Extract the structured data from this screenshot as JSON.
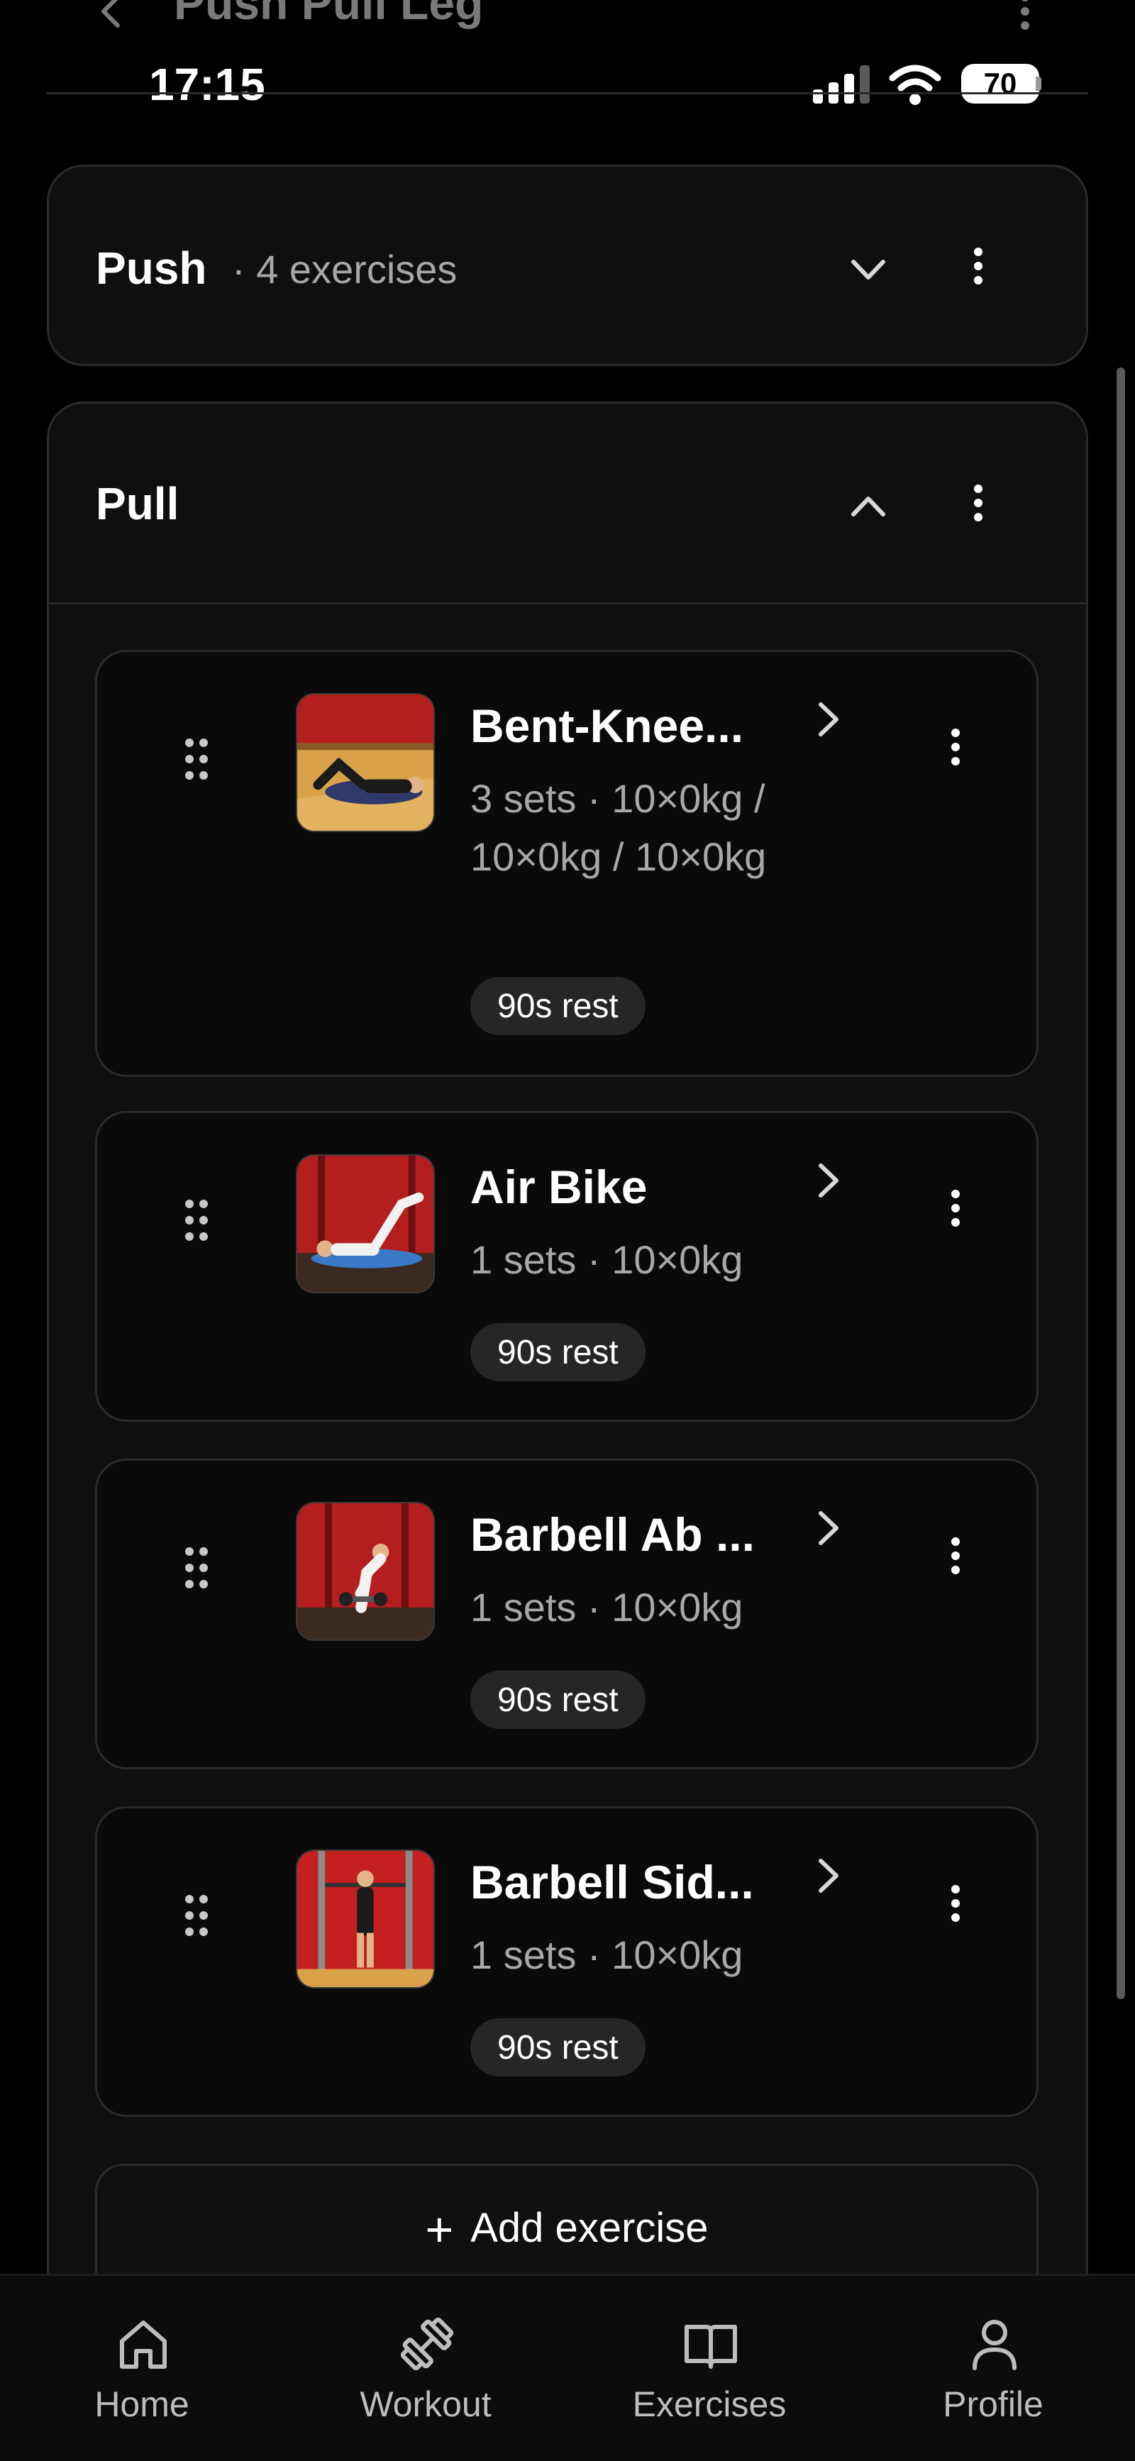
{
  "header": {
    "title": "Push Pull Leg",
    "time": "17:15",
    "battery": "70"
  },
  "days": [
    {
      "name": "Push",
      "count_text": "· 4 exercises",
      "expanded": false
    },
    {
      "name": "Pull",
      "expanded": true
    }
  ],
  "exercises": [
    {
      "name": "Bent-Knee...",
      "sets": "3 sets · 10×0kg / 10×0kg / 10×0kg",
      "rest": "90s rest",
      "thumb_icon": "person-lying-icon"
    },
    {
      "name": "Air Bike",
      "sets": "1 sets · 10×0kg",
      "rest": "90s rest",
      "thumb_icon": "person-air-bike-icon"
    },
    {
      "name": "Barbell Ab ...",
      "sets": "1 sets · 10×0kg",
      "rest": "90s rest",
      "thumb_icon": "person-barbell-rollout-icon"
    },
    {
      "name": "Barbell Sid...",
      "sets": "1 sets · 10×0kg",
      "rest": "90s rest",
      "thumb_icon": "person-barbell-standing-icon"
    }
  ],
  "add_exercise": {
    "plus": "+",
    "label": "Add exercise"
  },
  "nav": [
    {
      "label": "Home",
      "icon": "home-icon"
    },
    {
      "label": "Workout",
      "icon": "dumbbell-icon"
    },
    {
      "label": "Exercises",
      "icon": "book-icon"
    },
    {
      "label": "Profile",
      "icon": "user-icon"
    }
  ],
  "colors": {
    "background": "#000000",
    "card": "#0f0f0f",
    "border": "#2b2b2b",
    "pill": "#262626",
    "muted": "#a8a8a8"
  }
}
